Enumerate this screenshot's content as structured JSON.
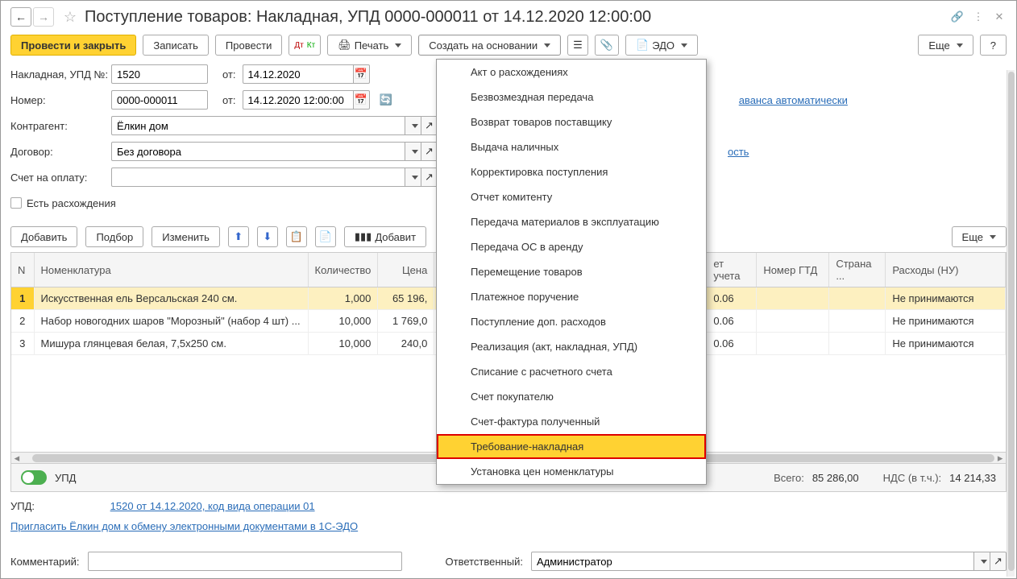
{
  "title": "Поступление товаров: Накладная, УПД 0000-000011 от 14.12.2020 12:00:00",
  "toolbar": {
    "post_close": "Провести и закрыть",
    "write": "Записать",
    "post": "Провести",
    "print": "Печать",
    "create_based": "Создать на основании",
    "edo": "ЭДО",
    "more": "Еще",
    "help": "?"
  },
  "form": {
    "nakl_label": "Накладная, УПД №:",
    "nakl_num": "1520",
    "ot": "от:",
    "nakl_date": "14.12.2020",
    "num_label": "Номер:",
    "num_value": "0000-000011",
    "num_date": "14.12.2020 12:00:00",
    "avans_link_part": "аванса автоматически",
    "contr_label": "Контрагент:",
    "contr_value": "Ёлкин дом",
    "dog_label": "Договор:",
    "dog_value": "Без договора",
    "dog_link_part": "ость",
    "schet_label": "Счет на оплату:",
    "rasx_check": "Есть расхождения"
  },
  "items_tb": {
    "add": "Добавить",
    "select": "Подбор",
    "change": "Изменить",
    "add_sh": "Добавит",
    "more": "Еще"
  },
  "table": {
    "cols": {
      "n": "N",
      "nom": "Номенклатура",
      "qty": "Количество",
      "price": "Цена",
      "acct": "ет учета",
      "gtd": "Номер ГТД",
      "country": "Страна ...",
      "exp": "Расходы (НУ)"
    },
    "rows": [
      {
        "n": "1",
        "nom": "Искусственная ель Версальская 240 см.",
        "qty": "1,000",
        "price": "65 196,",
        "acct": "0.06",
        "exp": "Не принимаются"
      },
      {
        "n": "2",
        "nom": "Набор новогодних шаров \"Морозный\" (набор 4 шт) ...",
        "qty": "10,000",
        "price": "1 769,0",
        "acct": "0.06",
        "exp": "Не принимаются"
      },
      {
        "n": "3",
        "nom": "Мишура глянцевая белая, 7,5х250 см.",
        "qty": "10,000",
        "price": "240,0",
        "acct": "0.06",
        "exp": "Не принимаются"
      }
    ]
  },
  "summary": {
    "upd": "УПД",
    "vsego_l": "Всего:",
    "vsego_v": "85 286,00",
    "nds_l": "НДС (в т.ч.):",
    "nds_v": "14 214,33"
  },
  "footer": {
    "upd_l": "УПД:",
    "upd_link": "1520 от 14.12.2020, код вида операции 01",
    "invite": "Пригласить Ёлкин дом к обмену электронными документами в 1С-ЭДО",
    "comment_l": "Комментарий:",
    "resp_l": "Ответственный:",
    "resp_v": "Администратор"
  },
  "menu": {
    "items": [
      "Акт о расхождениях",
      "Безвозмездная передача",
      "Возврат товаров поставщику",
      "Выдача наличных",
      "Корректировка поступления",
      "Отчет комитенту",
      "Передача материалов в эксплуатацию",
      "Передача ОС в аренду",
      "Перемещение товаров",
      "Платежное поручение",
      "Поступление доп. расходов",
      "Реализация (акт, накладная, УПД)",
      "Списание с расчетного счета",
      "Счет покупателю",
      "Счет-фактура полученный",
      "Требование-накладная",
      "Установка цен номенклатуры"
    ],
    "highlighted_index": 15
  }
}
